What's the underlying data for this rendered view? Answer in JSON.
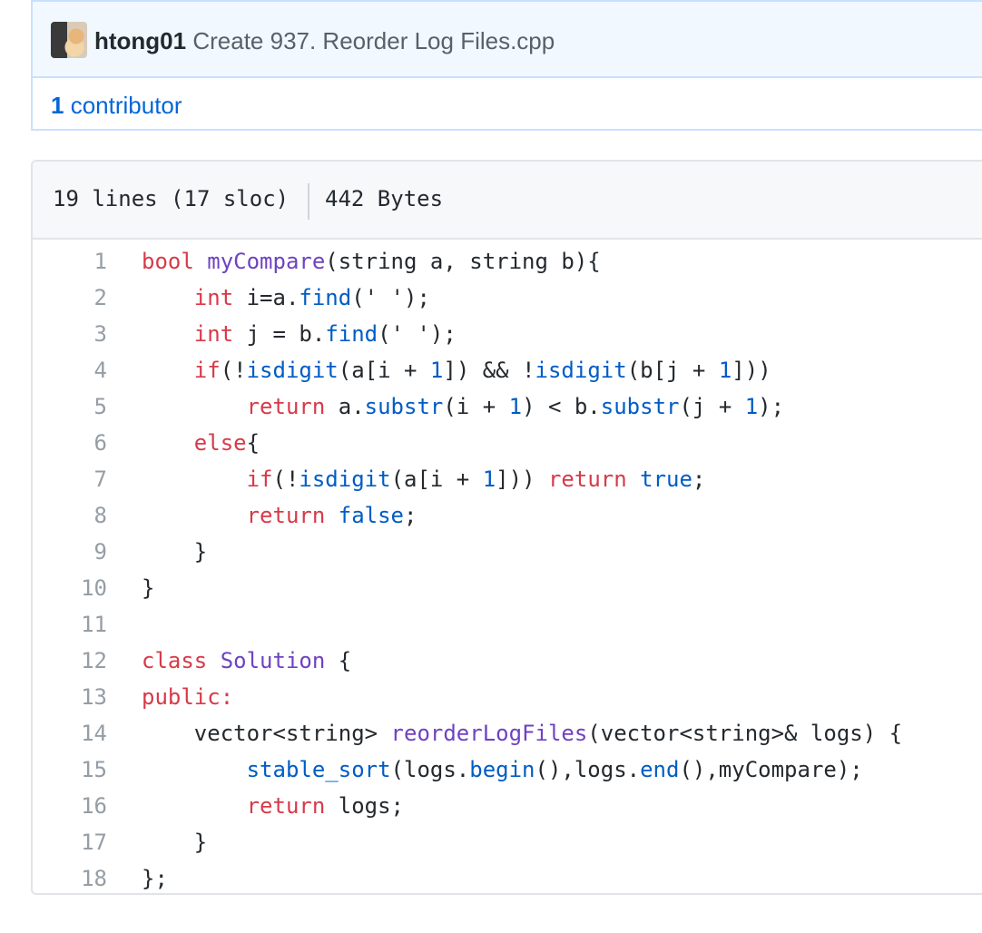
{
  "commit": {
    "author": "htong01",
    "message": "Create 937. Reorder Log Files.cpp",
    "avatar": "user-avatar"
  },
  "contributors": {
    "count": "1",
    "label": "contributor"
  },
  "file": {
    "lines_info": "19 lines (17 sloc)",
    "size": "442 Bytes",
    "code_lines": [
      [
        [
          "bool ",
          "k"
        ],
        [
          "myCompare",
          "f"
        ],
        [
          "(string a, string b){",
          ""
        ]
      ],
      [
        [
          "    ",
          ""
        ],
        [
          "int",
          "k"
        ],
        [
          " i=a.",
          ""
        ],
        [
          "find",
          "c"
        ],
        [
          "(' ');",
          ""
        ]
      ],
      [
        [
          "    ",
          ""
        ],
        [
          "int",
          "k"
        ],
        [
          " j = b.",
          ""
        ],
        [
          "find",
          "c"
        ],
        [
          "(' ');",
          ""
        ]
      ],
      [
        [
          "    ",
          ""
        ],
        [
          "if",
          "k"
        ],
        [
          "(!",
          ""
        ],
        [
          "isdigit",
          "c"
        ],
        [
          "(a[i + ",
          ""
        ],
        [
          "1",
          "c"
        ],
        [
          "]) && !",
          ""
        ],
        [
          "isdigit",
          "c"
        ],
        [
          "(b[j + ",
          ""
        ],
        [
          "1",
          "c"
        ],
        [
          "]))",
          ""
        ]
      ],
      [
        [
          "        ",
          ""
        ],
        [
          "return",
          "k"
        ],
        [
          " a.",
          ""
        ],
        [
          "substr",
          "c"
        ],
        [
          "(i + ",
          ""
        ],
        [
          "1",
          "c"
        ],
        [
          ") < b.",
          ""
        ],
        [
          "substr",
          "c"
        ],
        [
          "(j + ",
          ""
        ],
        [
          "1",
          "c"
        ],
        [
          ");",
          ""
        ]
      ],
      [
        [
          "    ",
          ""
        ],
        [
          "else",
          "k"
        ],
        [
          "{",
          ""
        ]
      ],
      [
        [
          "        ",
          ""
        ],
        [
          "if",
          "k"
        ],
        [
          "(!",
          ""
        ],
        [
          "isdigit",
          "c"
        ],
        [
          "(a[i + ",
          ""
        ],
        [
          "1",
          "c"
        ],
        [
          "])) ",
          ""
        ],
        [
          "return",
          "k"
        ],
        [
          " ",
          ""
        ],
        [
          "true",
          "c"
        ],
        [
          ";",
          ""
        ]
      ],
      [
        [
          "        ",
          ""
        ],
        [
          "return",
          "k"
        ],
        [
          " ",
          ""
        ],
        [
          "false",
          "c"
        ],
        [
          ";",
          ""
        ]
      ],
      [
        [
          "    }",
          ""
        ]
      ],
      [
        [
          "}",
          ""
        ]
      ],
      [
        [
          "",
          ""
        ]
      ],
      [
        [
          "class ",
          "k"
        ],
        [
          "Solution",
          "f"
        ],
        [
          " {",
          ""
        ]
      ],
      [
        [
          "public:",
          "k"
        ]
      ],
      [
        [
          "    vector<string> ",
          ""
        ],
        [
          "reorderLogFiles",
          "f"
        ],
        [
          "(vector<string>& logs) {",
          ""
        ]
      ],
      [
        [
          "        ",
          ""
        ],
        [
          "stable_sort",
          "c"
        ],
        [
          "(logs.",
          ""
        ],
        [
          "begin",
          "c"
        ],
        [
          "(),logs.",
          ""
        ],
        [
          "end",
          "c"
        ],
        [
          "(),myCompare);",
          ""
        ]
      ],
      [
        [
          "        ",
          ""
        ],
        [
          "return",
          "k"
        ],
        [
          " logs;",
          ""
        ]
      ],
      [
        [
          "    }",
          ""
        ]
      ],
      [
        [
          "};",
          ""
        ]
      ]
    ]
  }
}
